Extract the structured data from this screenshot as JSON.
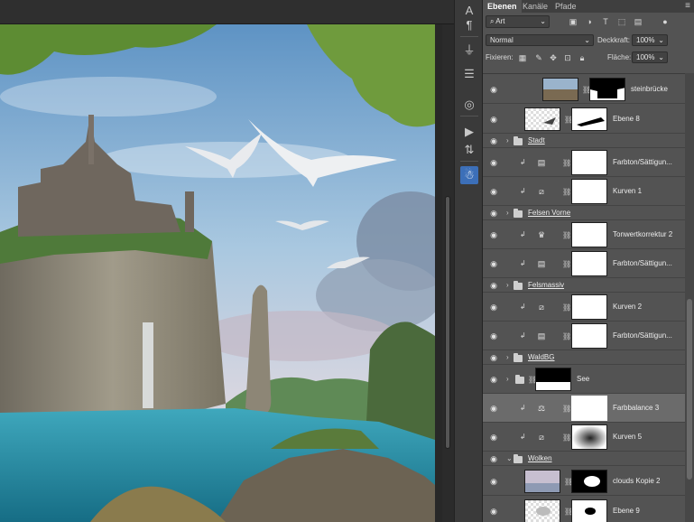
{
  "panel": {
    "tabs": [
      "Ebenen",
      "Kanäle",
      "Pfade"
    ],
    "filter_value": "Art",
    "blend_mode": "Normal",
    "opacity_label": "Deckkraft:",
    "opacity_value": "100%",
    "lock_label": "Fixieren:",
    "fill_label": "Fläche:",
    "fill_value": "100%"
  },
  "layers": [
    {
      "kind": "layer",
      "name": "steinbrücke"
    },
    {
      "kind": "layer",
      "name": "Ebene 8"
    },
    {
      "kind": "group",
      "name": "Stadt"
    },
    {
      "kind": "adjust",
      "name": "Farbton/Sättigun...",
      "icon": "hue-sat-icon"
    },
    {
      "kind": "adjust",
      "name": "Kurven 1",
      "icon": "curves-icon"
    },
    {
      "kind": "group",
      "name": "Felsen Vorne"
    },
    {
      "kind": "adjust",
      "name": "Tonwertkorrektur 2",
      "icon": "levels-icon"
    },
    {
      "kind": "adjust",
      "name": "Farbton/Sättigun...",
      "icon": "hue-sat-icon"
    },
    {
      "kind": "group",
      "name": "Felsmassiv"
    },
    {
      "kind": "adjust",
      "name": "Kurven 2",
      "icon": "curves-icon"
    },
    {
      "kind": "adjust",
      "name": "Farbton/Sättigun...",
      "icon": "hue-sat-icon"
    },
    {
      "kind": "group",
      "name": "WaldBG"
    },
    {
      "kind": "group-mask",
      "name": "See"
    },
    {
      "kind": "adjust",
      "name": "Farbbalance 3",
      "icon": "color-balance-icon",
      "selected": true
    },
    {
      "kind": "adjust",
      "name": "Kurven 5",
      "icon": "curves-icon"
    },
    {
      "kind": "group",
      "name": "Wolken",
      "open": true
    },
    {
      "kind": "layer",
      "name": "clouds Kopie 2"
    },
    {
      "kind": "layer",
      "name": "Ebene 9"
    }
  ],
  "tools": [
    "type-icon",
    "paragraph-icon",
    "usb-icon",
    "text-layout-icon",
    "swirl-icon",
    "play-icon",
    "swap-icon",
    "figure-icon"
  ],
  "colors": {
    "accent": "#3c6fb8",
    "panel": "#535353",
    "selected_row": "#6b6b6b"
  }
}
